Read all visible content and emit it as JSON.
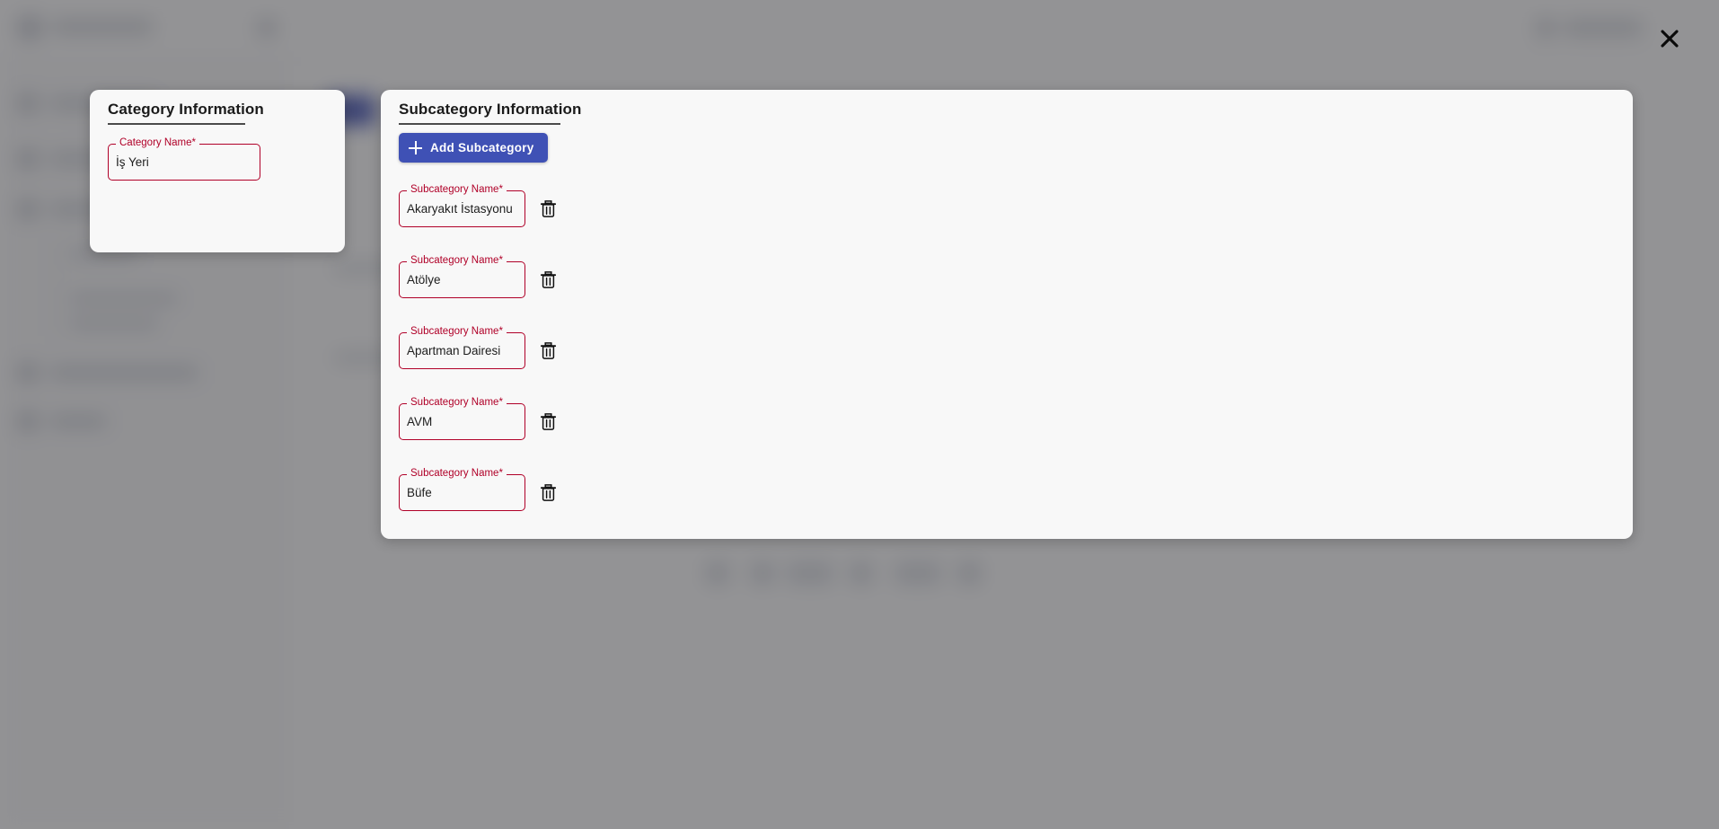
{
  "modal": {
    "close_label": "×",
    "close_icon": "close-icon"
  },
  "category_panel": {
    "title": "Category Information",
    "field": {
      "label": "Category Name*",
      "value": "İş Yeri",
      "placeholder": ""
    }
  },
  "subcategory_panel": {
    "title": "Subcategory Information",
    "add_button": {
      "label": "Add Subcategory",
      "icon": "plus-icon",
      "color": "#3f51b5"
    },
    "field_label": "Subcategory Name*",
    "delete_icon": "trash-icon",
    "items": [
      {
        "label": "Subcategory Name*",
        "value": "Akaryakıt İstasyonu"
      },
      {
        "label": "Subcategory Name*",
        "value": "Atölye"
      },
      {
        "label": "Subcategory Name*",
        "value": "Apartman Dairesi"
      },
      {
        "label": "Subcategory Name*",
        "value": "AVM"
      },
      {
        "label": "Subcategory Name*",
        "value": "Büfe"
      }
    ]
  },
  "colors": {
    "error": "#b00028",
    "primary": "#3f51b5",
    "panel_bg": "#f8f8f8",
    "scrim": "rgba(58,58,62,0.55)",
    "title_text": "#1b1b1b"
  }
}
